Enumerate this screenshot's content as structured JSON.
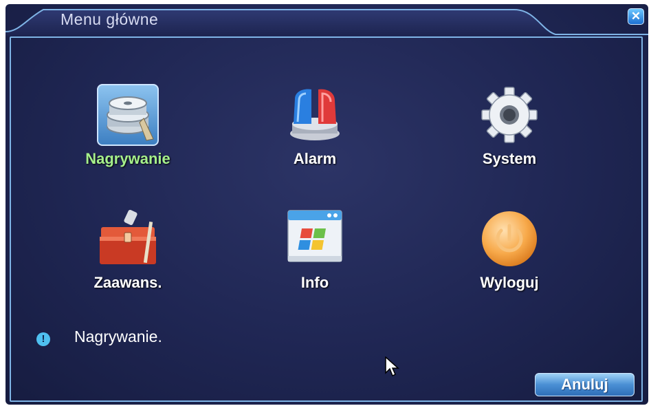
{
  "window": {
    "title": "Menu główne",
    "close_label": "✕"
  },
  "menu": {
    "items": [
      {
        "label": "Nagrywanie",
        "icon": "film-reel-icon",
        "selected": true
      },
      {
        "label": "Alarm",
        "icon": "siren-icon",
        "selected": false
      },
      {
        "label": "System",
        "icon": "gear-icon",
        "selected": false
      },
      {
        "label": "Zaawans.",
        "icon": "toolbox-icon",
        "selected": false
      },
      {
        "label": "Info",
        "icon": "info-window-icon",
        "selected": false
      },
      {
        "label": "Wyloguj",
        "icon": "power-icon",
        "selected": false
      }
    ]
  },
  "status": {
    "icon": "exclamation-info-icon",
    "icon_glyph": "!",
    "text": "Nagrywanie."
  },
  "footer": {
    "cancel_label": "Anuluj"
  },
  "colors": {
    "background": "#1f2653",
    "frame": "#7fb4e6",
    "selected_label": "#a6f08b",
    "label": "#ffffff",
    "button": "#4a8fd4"
  }
}
